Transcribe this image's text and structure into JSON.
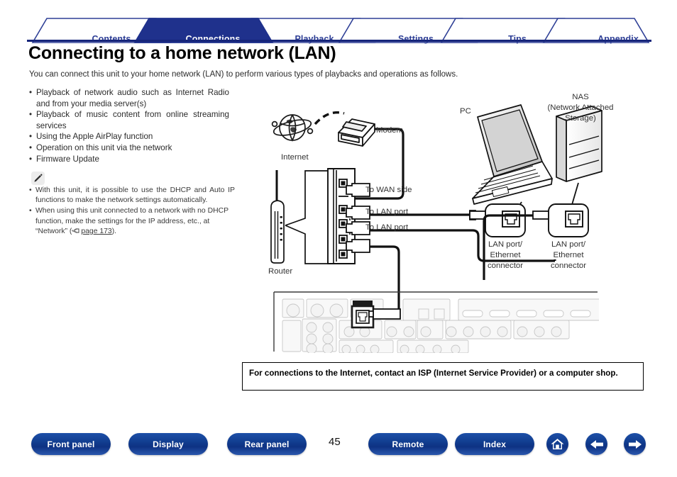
{
  "tabs": [
    {
      "label": "Contents",
      "active": false
    },
    {
      "label": "Connections",
      "active": true
    },
    {
      "label": "Playback",
      "active": false
    },
    {
      "label": "Settings",
      "active": false
    },
    {
      "label": "Tips",
      "active": false
    },
    {
      "label": "Appendix",
      "active": false
    }
  ],
  "title": "Connecting to a home network (LAN)",
  "intro": "You can connect this unit to your home network (LAN) to perform various types of playbacks and operations as follows.",
  "bullets": [
    "Playback of network audio such as Internet Radio and from your media server(s)",
    "Playback of music content from online streaming services",
    "Using the Apple AirPlay function",
    "Operation on this unit via the network",
    "Firmware Update"
  ],
  "note_icon": "pencil-icon",
  "notes": [
    "With this unit, it is possible to use the DHCP and Auto IP functions to make the network settings automatically.",
    "When using this unit connected to a network with no DHCP function, make the settings for the IP address, etc., at “Network” ("
  ],
  "note_link": "page 173",
  "note_tail": ").",
  "diagram": {
    "internet_label": "Internet",
    "modem_label": "Modem",
    "router_label": "Router",
    "pc_label": "PC",
    "nas_label_line1": "NAS",
    "nas_label_line2": "(Network Attached",
    "nas_label_line3": "Storage)",
    "to_wan": "To WAN side",
    "to_lan_1": "To LAN port",
    "to_lan_2": "To LAN port",
    "pc_port_line1": "LAN port/",
    "pc_port_line2": "Ethernet",
    "pc_port_line3": "connector",
    "nas_port_line1": "LAN port/",
    "nas_port_line2": "Ethernet",
    "nas_port_line3": "connector"
  },
  "notebox": "For connections to the Internet, contact an ISP (Internet Service Provider) or a computer shop.",
  "footer": {
    "buttons": [
      {
        "label": "Front panel",
        "name": "front-panel-button"
      },
      {
        "label": "Display",
        "name": "display-button"
      },
      {
        "label": "Rear panel",
        "name": "rear-panel-button"
      },
      {
        "label": "Remote",
        "name": "remote-button"
      },
      {
        "label": "Index",
        "name": "index-button"
      }
    ],
    "page_number": "45",
    "icons": [
      "home-icon",
      "back-arrow-icon",
      "forward-arrow-icon"
    ]
  },
  "colors": {
    "tab_active_bg": "#1f318c",
    "tab_text": "#2e3f96",
    "rule": "#16257a",
    "pill": "#123f91"
  }
}
